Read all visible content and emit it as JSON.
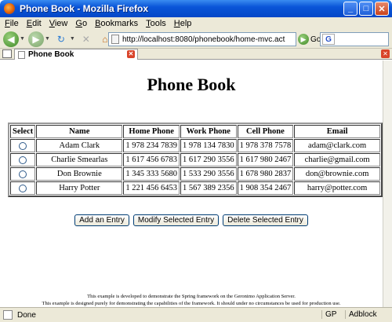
{
  "window": {
    "title": "Phone Book - Mozilla Firefox"
  },
  "menu": [
    "File",
    "Edit",
    "View",
    "Go",
    "Bookmarks",
    "Tools",
    "Help"
  ],
  "nav": {
    "url": "http://localhost:8080/phonebook/home-mvc.act",
    "go_label": "Go"
  },
  "tab": {
    "label": "Phone Book"
  },
  "page": {
    "title": "Phone Book",
    "columns": [
      "Select",
      "Name",
      "Home Phone",
      "Work Phone",
      "Cell Phone",
      "Email"
    ],
    "rows": [
      [
        "Adam Clark",
        "1 978 234 7839",
        "1 978 134 7830",
        "1 978 378 7578",
        "adam@clark.com"
      ],
      [
        "Charlie Smearlas",
        "1 617 456 6783",
        "1 617 290 3556",
        "1 617 980 2467",
        "charlie@gmail.com"
      ],
      [
        "Don Brownie",
        "1 345 333 5680",
        "1 533 290 3556",
        "1 678 980 2837",
        "don@brownie.com"
      ],
      [
        "Harry Potter",
        "1 221 456 6453",
        "1 567 389 2356",
        "1 908 354 2467",
        "harry@potter.com"
      ]
    ],
    "buttons": {
      "add": "Add an Entry",
      "modify": "Modify Selected Entry",
      "delete": "Delete Selected Entry"
    },
    "footer_line1": "This example is developed to demonstrate the Spring framework on the Geronimo Application Server.",
    "footer_line2": "This example is designed purely for demonstrating the capabilities of the framework. It should under no circumstances be used for production use."
  },
  "status": {
    "text": "Done",
    "gp": "GP",
    "adblock": "Adblock"
  }
}
